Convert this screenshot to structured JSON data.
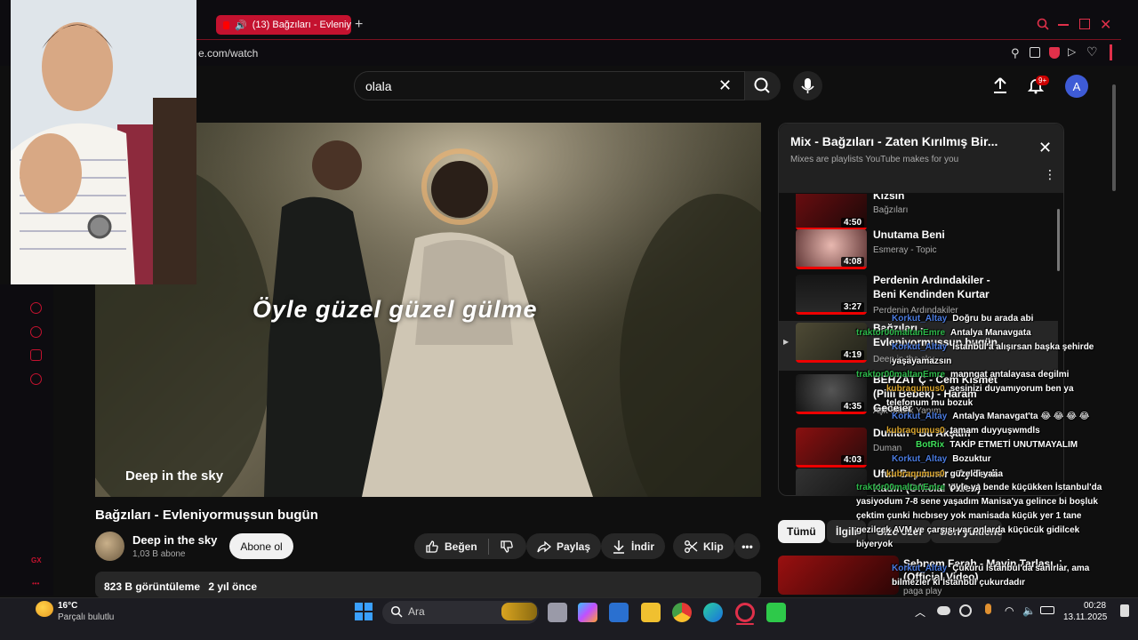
{
  "browser": {
    "tab_title": "(13) Bağzıları - Evleniy",
    "address": "e.com/watch"
  },
  "header": {
    "search_value": "olala",
    "notification_count": "9+",
    "avatar_letter": "A"
  },
  "video": {
    "lyric": "Öyle güzel güzel gülme",
    "overlay_channel": "Deep in the sky",
    "title": "Bağzıları - Evleniyormuşsun bugün",
    "channel": "Deep in the sky",
    "subscribers": "1,03 B abone",
    "subscribe_label": "Abone ol",
    "like_label": "Beğen",
    "share_label": "Paylaş",
    "download_label": "İndir",
    "clip_label": "Klip",
    "views": "823 B görüntüleme",
    "age": "2 yıl önce"
  },
  "playlist": {
    "title": "Mix - Bağzıları - Zaten Kırılmış Bir...",
    "subtitle": "Mixes are playlists YouTube makes for you",
    "items": [
      {
        "title": "Kızsın",
        "channel": "Bağzıları",
        "duration": "4:50"
      },
      {
        "title": "Unutama Beni",
        "channel": "Esmeray - Topic",
        "duration": "4:08"
      },
      {
        "title": "Perdenin Ardındakiler - Beni Kendinden Kurtar",
        "channel": "Perdenin Ardındakiler",
        "duration": "3:27"
      },
      {
        "title": "Bağzıları - Evleniyormuşsun bugün",
        "channel": "Deep in the sky",
        "duration": "4:19"
      },
      {
        "title": "BEHZAT Ç - Cem Kısmet (Pilli Bebek) - Haram Geceler",
        "channel": "Aşk Müzik Yapım",
        "duration": "4:35"
      },
      {
        "title": "Duman - Bu Akşam",
        "channel": "Duman",
        "duration": "4:03"
      },
      {
        "title": "Ufuk Beydemir - Ay Tenli Kadın (Official Video)",
        "channel": "",
        "duration": ""
      }
    ]
  },
  "chips": [
    "Tümü",
    "İlgili",
    "Size özel",
    "Son yüklenenler"
  ],
  "rec": {
    "title": "Şebnem Ferah - Mavin Tarlası (Official Video)",
    "meta": "paga play"
  },
  "chat": [
    {
      "user": "Korkut_Altay",
      "msg": "Doğru bu arada abi",
      "ucolor": "#4a7be0"
    },
    {
      "user": "traktor00maltanEmre",
      "msg": "Antalya Manavgata",
      "ucolor": "#2db84a"
    },
    {
      "user": "Korkut_Altay",
      "msg": "İstanbul'a alışırsan başka şehirde yaşayamazsın",
      "ucolor": "#4a7be0"
    },
    {
      "user": "traktor00maltanEmre",
      "msg": "manngat antalayasa degilmi",
      "ucolor": "#2db84a"
    },
    {
      "user": "kubraqumus0",
      "msg": "sesinizi duyamıyorum ben ya telefonum mu bozuk",
      "ucolor": "#d9a42c"
    },
    {
      "user": "Korkut_Altay",
      "msg": "Antalya Manavgat'ta 😂 😂 😂 😂",
      "ucolor": "#4a7be0"
    },
    {
      "user": "kubraqumus0",
      "msg": "tamam duyyuşwmdls",
      "ucolor": "#d9a42c"
    },
    {
      "user": "BotRix",
      "msg": "TAKİP ETMETİ UNUTMAYALIM",
      "ucolor": "#3fe05a"
    },
    {
      "user": "Korkut_Altay",
      "msg": "Bozuktur",
      "ucolor": "#4a7be0"
    },
    {
      "user": "kubraqumus0",
      "msg": "güzeldi yaaa",
      "ucolor": "#d9a42c"
    },
    {
      "user": "traktor00maltanEmre",
      "msg": "öyle ya bende küçükken İstanbul'da yasiyodum 7-8 sene yaşadım Manisa'ya gelince bi boşluk çektim çunki hıcbısey yok manisada küçük yer 1 tane gezilcek AVM ve çarşısı var onlarda küçücük gidilcek biyeryok",
      "ucolor": "#2db84a"
    },
    {
      "user": "Korkut_Altay",
      "msg": "Çukuru İstanbul'da sanırlar, ama bilmezler ki İstanbul çukurdadır",
      "ucolor": "#4a7be0"
    }
  ],
  "taskbar": {
    "weather_temp": "16°C",
    "weather_desc": "Parçalı bulutlu",
    "search_label": "Ara",
    "time": "00:28",
    "date": "13.11.2025"
  },
  "colors": {
    "accent": "#c4122f",
    "yt_red": "#ff0000",
    "bg": "#0f0f0f"
  }
}
